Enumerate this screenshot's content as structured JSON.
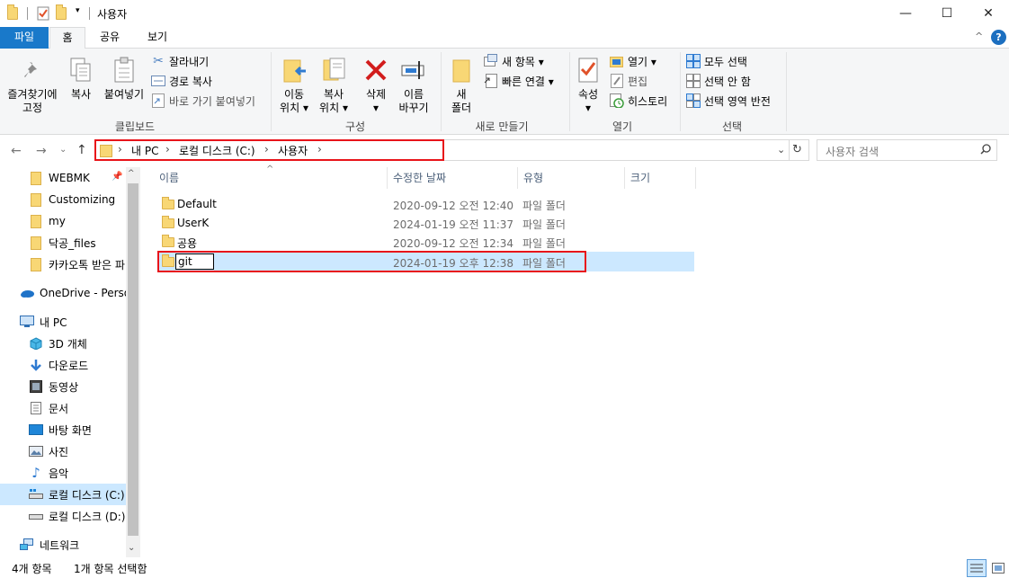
{
  "window": {
    "title": "사용자",
    "minimize": "—",
    "maximize": "☐",
    "close": "✕"
  },
  "ribbon_tabs": {
    "file": "파일",
    "home": "홈",
    "share": "공유",
    "view": "보기"
  },
  "ribbon": {
    "clipboard": {
      "pin_label": "즐겨찾기에",
      "pin_label2": "고정",
      "copy": "복사",
      "paste": "붙여넣기",
      "cut": "잘라내기",
      "copy_path": "경로 복사",
      "paste_shortcut": "바로 가기 붙여넣기",
      "group": "클립보드"
    },
    "organize": {
      "move_to": "이동",
      "move_to2": "위치",
      "copy_to": "복사",
      "copy_to2": "위치",
      "delete": "삭제",
      "rename": "이름",
      "rename2": "바꾸기",
      "group": "구성"
    },
    "new": {
      "new_folder": "새",
      "new_folder2": "폴더",
      "new_item": "새 항목",
      "easy_access": "빠른 연결",
      "group": "새로 만들기"
    },
    "open": {
      "properties": "속성",
      "open": "열기",
      "edit": "편집",
      "history": "히스토리",
      "group": "열기"
    },
    "select": {
      "select_all": "모두 선택",
      "select_none": "선택 안 함",
      "invert": "선택 영역 반전",
      "group": "선택"
    }
  },
  "address": {
    "crumbs": [
      "내 PC",
      "로컬 디스크 (C:)",
      "사용자"
    ],
    "search_placeholder": "사용자 검색"
  },
  "nav_pane": {
    "quick_access": [
      "WEBMK",
      "Customizing",
      "my",
      "닥공_files",
      "카카오톡 받은 파"
    ],
    "onedrive": "OneDrive - Person",
    "this_pc": "내 PC",
    "pc_items": [
      "3D 개체",
      "다운로드",
      "동영상",
      "문서",
      "바탕 화면",
      "사진",
      "음악",
      "로컬 디스크 (C:)",
      "로컬 디스크 (D:)"
    ],
    "network": "네트워크"
  },
  "columns": {
    "name": "이름",
    "modified": "수정한 날짜",
    "type": "유형",
    "size": "크기"
  },
  "files": [
    {
      "name": "Default",
      "modified": "2020-09-12 오전 12:40",
      "type": "파일 폴더"
    },
    {
      "name": "UserK",
      "modified": "2024-01-19 오전 11:37",
      "type": "파일 폴더"
    },
    {
      "name": "공용",
      "modified": "2020-09-12 오전 12:34",
      "type": "파일 폴더"
    },
    {
      "name": "git",
      "modified": "2024-01-19 오후 12:38",
      "type": "파일 폴더"
    }
  ],
  "status": {
    "count": "4개 항목",
    "selected": "1개 항목 선택함"
  },
  "colors": {
    "accent": "#1979ca",
    "highlight": "#e8141a",
    "selection": "#cce8ff",
    "folder": "#f8d775"
  }
}
